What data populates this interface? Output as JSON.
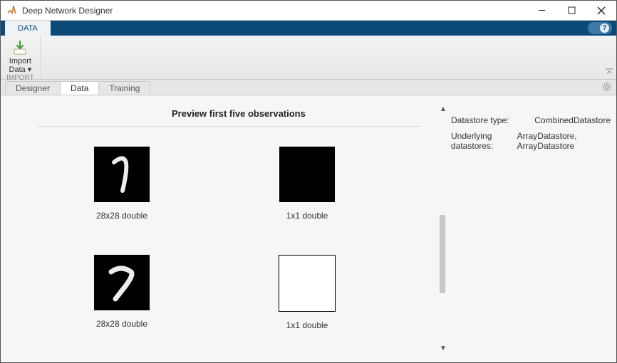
{
  "window": {
    "title": "Deep Network Designer"
  },
  "toolstrip": {
    "tab_label": "DATA",
    "help_text": "?"
  },
  "ribbon": {
    "import": {
      "label_line1": "Import",
      "label_line2": "Data"
    },
    "group_title": "IMPORT"
  },
  "doc_tabs": {
    "designer": "Designer",
    "data": "Data",
    "training": "Training"
  },
  "preview": {
    "header": "Preview first five observations",
    "rows": [
      {
        "left_caption": "28x28 double",
        "right_caption": "1x1 double"
      },
      {
        "left_caption": "28x28 double",
        "right_caption": "1x1 double"
      }
    ]
  },
  "info": {
    "datastore_type_label": "Datastore type:",
    "datastore_type_value": "CombinedDatastore",
    "underlying_label": "Underlying datastores:",
    "underlying_value": "ArrayDatastore, ArrayDatastore"
  }
}
